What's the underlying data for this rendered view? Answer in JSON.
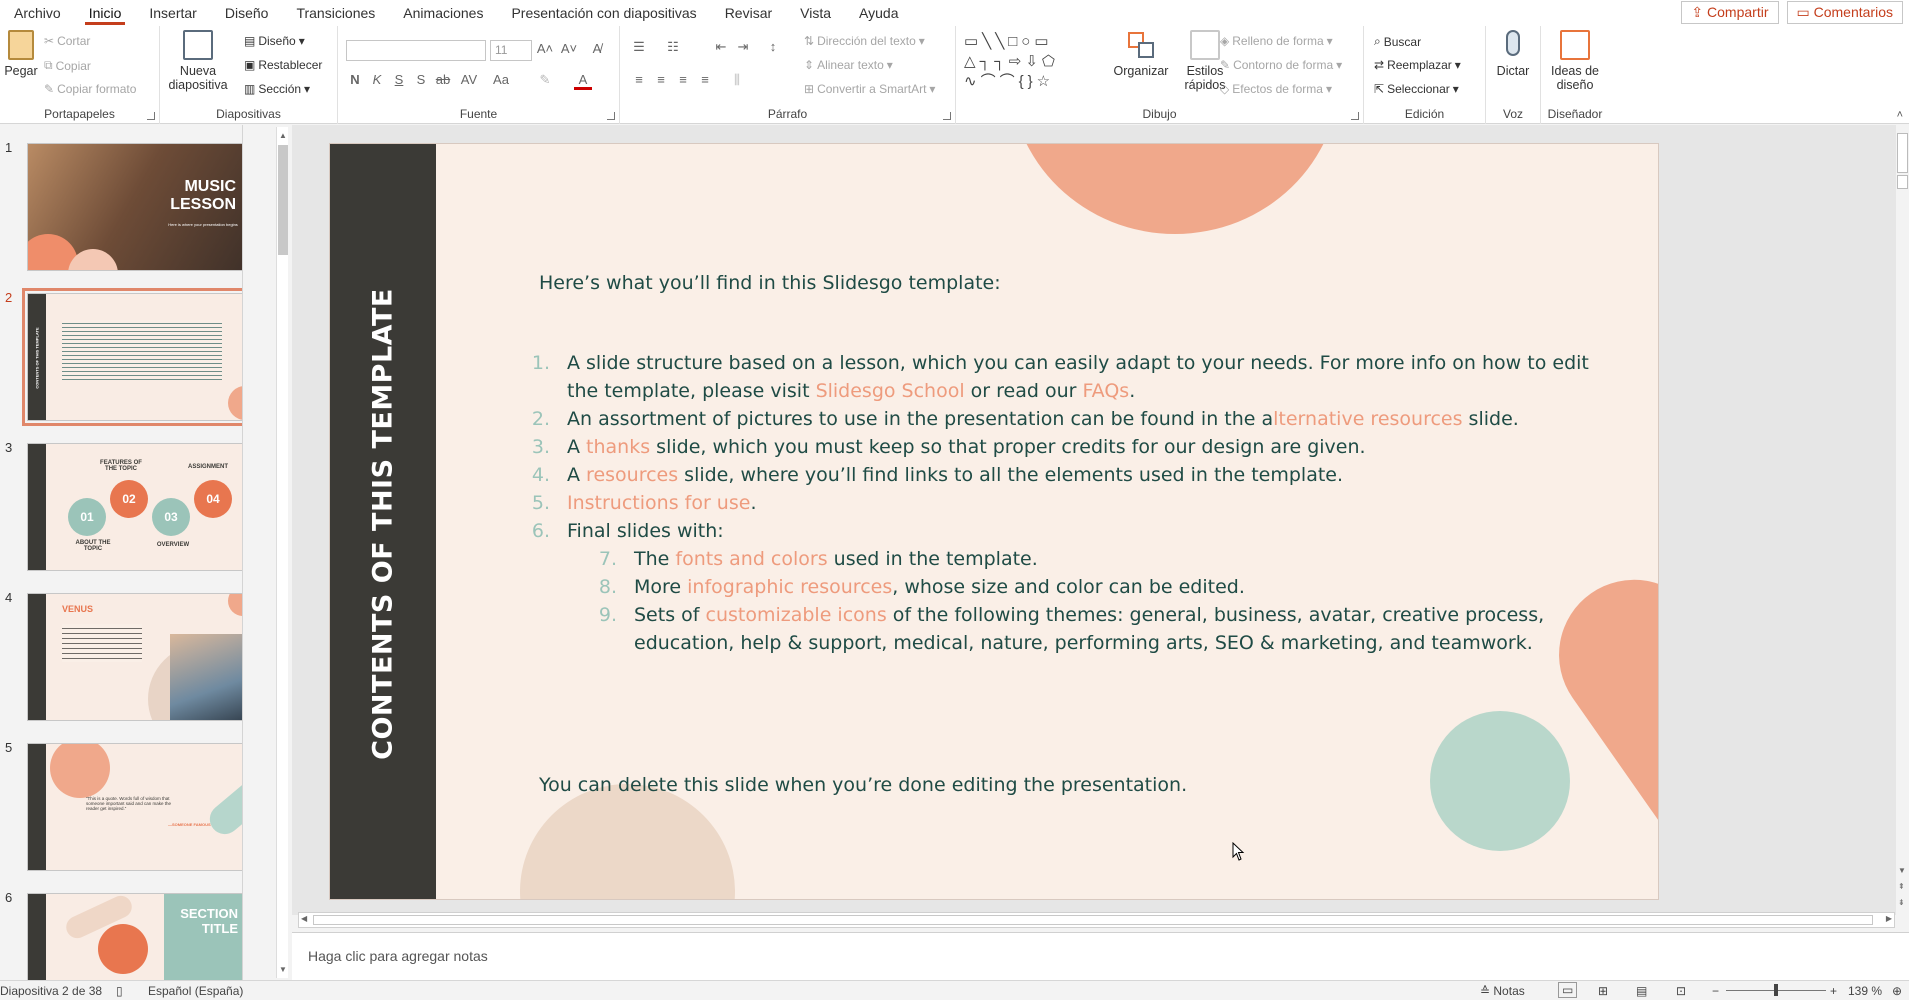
{
  "tabs": [
    "Archivo",
    "Inicio",
    "Insertar",
    "Diseño",
    "Transiciones",
    "Animaciones",
    "Presentación con diapositivas",
    "Revisar",
    "Vista",
    "Ayuda"
  ],
  "active_tab": "Inicio",
  "share_label": "Compartir",
  "comments_label": "Comentarios",
  "ribbon": {
    "portapapeles": {
      "label": "Portapapeles",
      "paste": "Pegar",
      "cut": "Cortar",
      "copy": "Copiar",
      "format_painter": "Copiar formato"
    },
    "diapositivas": {
      "label": "Diapositivas",
      "new_slide": "Nueva diapositiva",
      "layout": "Diseño",
      "reset": "Restablecer",
      "section": "Sección"
    },
    "fuente": {
      "label": "Fuente",
      "font_size": "11"
    },
    "parrafo": {
      "label": "Párrafo",
      "text_direction": "Dirección del texto",
      "align_text": "Alinear texto",
      "smartart": "Convertir a SmartArt"
    },
    "dibujo": {
      "label": "Dibujo",
      "arrange": "Organizar",
      "quick_styles": "Estilos rápidos",
      "shape_fill": "Relleno de forma",
      "shape_outline": "Contorno de forma",
      "shape_effects": "Efectos de forma"
    },
    "edicion": {
      "label": "Edición",
      "find": "Buscar",
      "replace": "Reemplazar",
      "select": "Seleccionar"
    },
    "voz": {
      "label": "Voz",
      "dictate": "Dictar"
    },
    "disenador": {
      "label": "Diseñador",
      "design_ideas": "Ideas de diseño"
    }
  },
  "thumbnails": [
    {
      "num": "1",
      "title": "MUSIC LESSON",
      "subtitle": "Here is where your presentation begins"
    },
    {
      "num": "2",
      "title": "CONTENTS OF THIS TEMPLATE"
    },
    {
      "num": "3",
      "labels": [
        "FEATURES OF THE TOPIC",
        "ASSIGNMENT",
        "ABOUT THE TOPIC",
        "OVERVIEW"
      ],
      "circles": [
        "01",
        "02",
        "03",
        "04"
      ]
    },
    {
      "num": "4",
      "title": "VENUS"
    },
    {
      "num": "5",
      "quote": "“This is a quote. Words full of wisdom that someone important said and can make the reader get inspired.”",
      "author": "—SOMEONE FAMOUS"
    },
    {
      "num": "6",
      "title": "SECTION TITLE"
    }
  ],
  "slide": {
    "sidebar_title": "CONTENTS OF THIS TEMPLATE",
    "intro": "Here’s what you’ll find in this Slidesgo template:",
    "items": [
      {
        "n": "1.",
        "parts": [
          "A slide structure based on a lesson, which you can easily adapt to your needs. For more info on how to edit"
        ],
        "line2a": "the template, please visit ",
        "link1": "Slidesgo School",
        "mid": " or read our ",
        "link2": "FAQs",
        "end": "."
      },
      {
        "n": "2.",
        "pre": "An assortment of pictures to use in the presentation can be found in the a",
        "link": "lternative resources",
        "post": " slide."
      },
      {
        "n": "3.",
        "pre": "A ",
        "link": "thanks",
        "post": " slide, which you must keep so that proper credits for our design are given."
      },
      {
        "n": "4.",
        "pre": "A ",
        "link": "resources",
        "post": " slide, where you’ll find links to all the elements used in the template."
      },
      {
        "n": "5.",
        "link": "Instructions for use",
        "post": "."
      },
      {
        "n": "6.",
        "pre": "Final slides with:"
      },
      {
        "n": "7.",
        "pre": "The ",
        "link": "fonts and colors",
        "post": " used in the template."
      },
      {
        "n": "8.",
        "pre": "More ",
        "link": "infographic resources",
        "post": ", whose size and color can be edited."
      },
      {
        "n": "9.",
        "pre": "Sets of ",
        "link": "customizable icons",
        "post": " of the following themes: general, business, avatar, creative process,",
        "line2": "education, help & support, medical, nature, performing arts, SEO & marketing, and teamwork."
      }
    ],
    "footer": "You can delete this slide when you’re done editing the presentation."
  },
  "notes_placeholder": "Haga clic para agregar notas",
  "status": {
    "slide_count": "Diapositiva 2 de 38",
    "language": "Español (España)",
    "notes": "Notas",
    "zoom": "139 %"
  },
  "colors": {
    "accent": "#c43e1c",
    "slide_bg": "#faefe7",
    "sidebar": "#3b3a36",
    "text": "#1f4b45",
    "link": "#ee9b7d",
    "teal": "#9bc4b9",
    "peach": "#f0a88b"
  }
}
